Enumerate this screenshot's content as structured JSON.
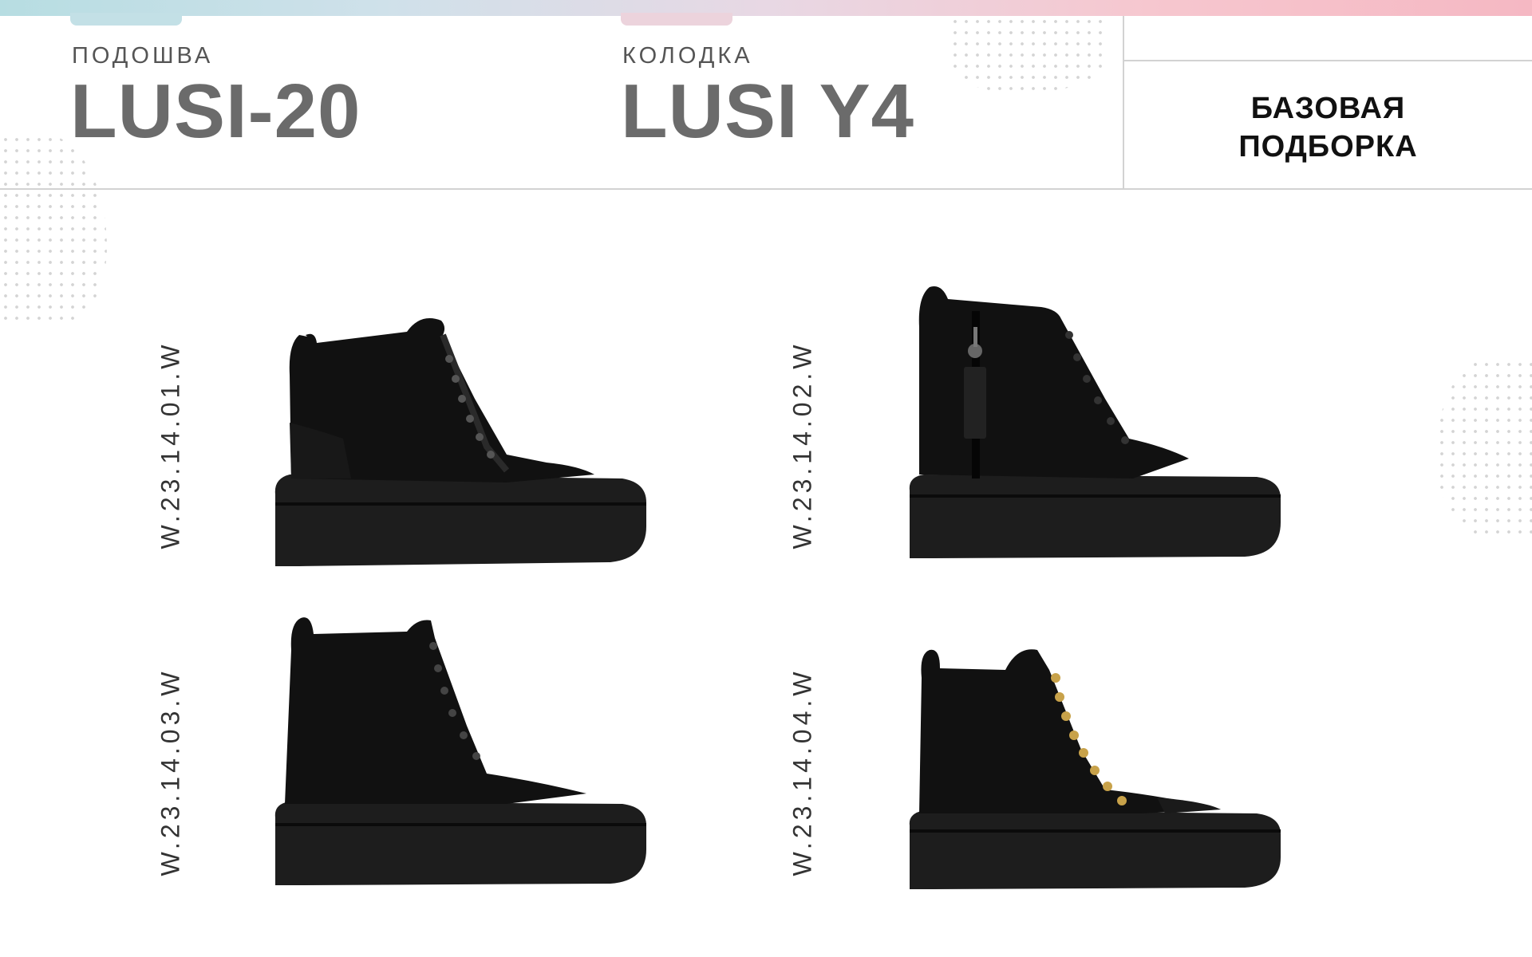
{
  "header": {
    "sole_label": "ПОДОШВА",
    "sole_name": "LUSI-20",
    "last_label": "КОЛОДКА",
    "last_name": "LUSI Y4",
    "collection_line1": "БАЗОВАЯ",
    "collection_line2": "ПОДБОРКА"
  },
  "products": [
    {
      "article": "W.23.14.01.W",
      "image": "black-suede-high-top-boot-icon"
    },
    {
      "article": "W.23.14.02.W",
      "image": "black-leather-zip-high-top-boot-icon"
    },
    {
      "article": "W.23.14.03.W",
      "image": "black-suede-lace-up-boot-icon"
    },
    {
      "article": "W.23.14.04.W",
      "image": "black-suede-gold-hook-boot-icon"
    }
  ],
  "colors": {
    "title_gray": "#6b6b6b",
    "boot_black": "#111111",
    "sole_black": "#1d1d1d",
    "gold_hooks": "#c8a24a"
  }
}
